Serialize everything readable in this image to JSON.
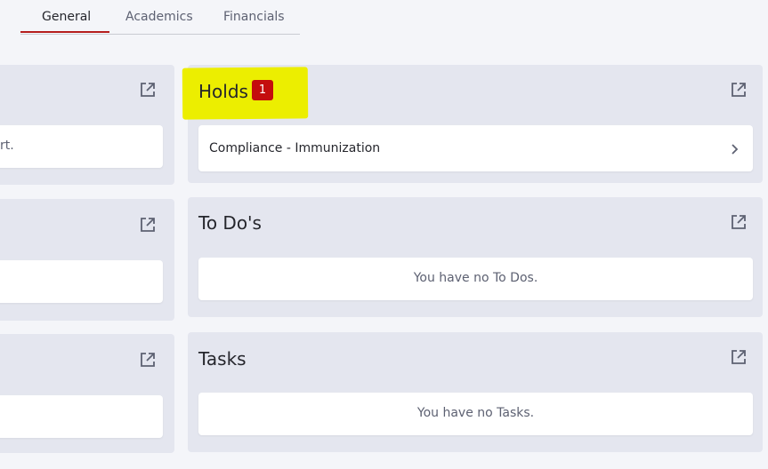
{
  "tabs": [
    {
      "label": "General",
      "active": true
    },
    {
      "label": "Academics",
      "active": false
    },
    {
      "label": "Financials",
      "active": false
    }
  ],
  "left_cards": [
    {
      "partial_text": "rt."
    },
    {
      "partial_text": ""
    },
    {
      "partial_text": ""
    }
  ],
  "holds": {
    "title": "Holds",
    "count": "1",
    "item": "Compliance - Immunization"
  },
  "todos": {
    "title": "To Do's",
    "empty": "You have no To Dos."
  },
  "tasks": {
    "title": "Tasks",
    "empty": "You have no Tasks."
  },
  "colors": {
    "accent": "#b51d1d",
    "badge": "#c40d0d",
    "highlight": "#ecee00",
    "card_bg": "#e4e6ef",
    "page_bg": "#f4f5f9"
  },
  "icons": {
    "external_link": "external-link-icon",
    "chevron": "chevron-right-icon"
  }
}
